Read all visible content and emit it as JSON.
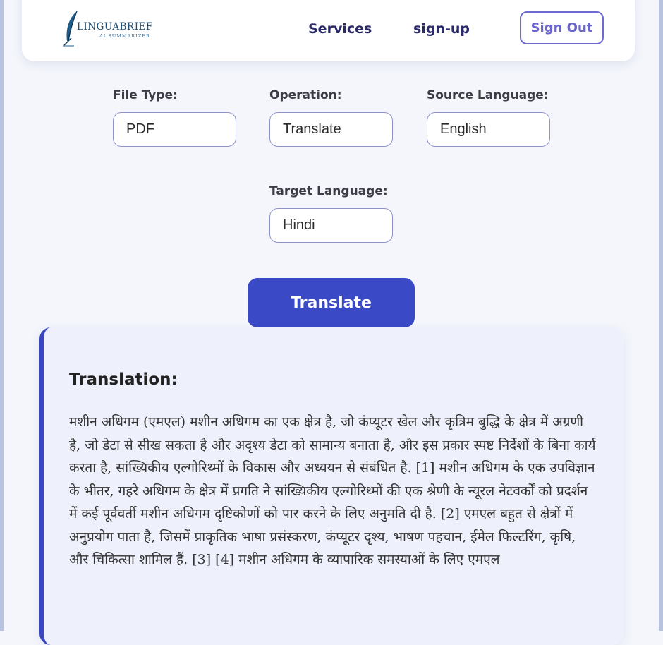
{
  "brand": {
    "name": "LINGUABRIEF",
    "tagline": "AI SUMMARIZER"
  },
  "nav": {
    "services": "Services",
    "signup": "sign-up",
    "signout": "Sign Out"
  },
  "form": {
    "file_type": {
      "label": "File Type:",
      "value": "PDF"
    },
    "operation": {
      "label": "Operation:",
      "value": "Translate"
    },
    "source_language": {
      "label": "Source Language:",
      "value": "English"
    },
    "target_language": {
      "label": "Target Language:",
      "value": "Hindi"
    },
    "submit": "Translate"
  },
  "result": {
    "title": "Translation:",
    "text": "मशीन अधिगम (एमएल) मशीन अधिगम का एक क्षेत्र है, जो कंप्यूटर खेल और कृत्रिम बुद्धि के क्षेत्र में अग्रणी है, जो डेटा से सीख सकता है और अदृश्य डेटा को सामान्य बनाता है, और इस प्रकार स्पष्ट निर्देशों के बिना कार्य करता है, सांख्यिकीय एल्गोरिथ्मों के विकास और अध्ययन से संबंधित है. [1] मशीन अधिगम के एक उपविज्ञान के भीतर, गहरे अधिगम के क्षेत्र में प्रगति ने सांख्यिकीय एल्गोरिथ्मों की एक श्रेणी के न्यूरल नेटवर्कों को प्रदर्शन में कई पूर्ववर्ती मशीन अधिगम दृष्टिकोणों को पार करने के लिए अनुमति दी है. [2] एमएल बहुत से क्षेत्रों में अनुप्रयोग पाता है, जिसमें प्राकृतिक भाषा प्रसंस्करण, कंप्यूटर दृश्य, भाषण पहचान, ईमेल फिल्टरिंग, कृषि, और चिकित्सा शामिल हैं. [3] [4] मशीन अधिगम के व्यापारिक समस्याओं के लिए एमएल"
  },
  "icons": {
    "logo": "quill-feather-icon"
  },
  "colors": {
    "accent": "#3a4ac7",
    "signout_border": "#6e6ad0",
    "card_bar": "#3845c4"
  }
}
